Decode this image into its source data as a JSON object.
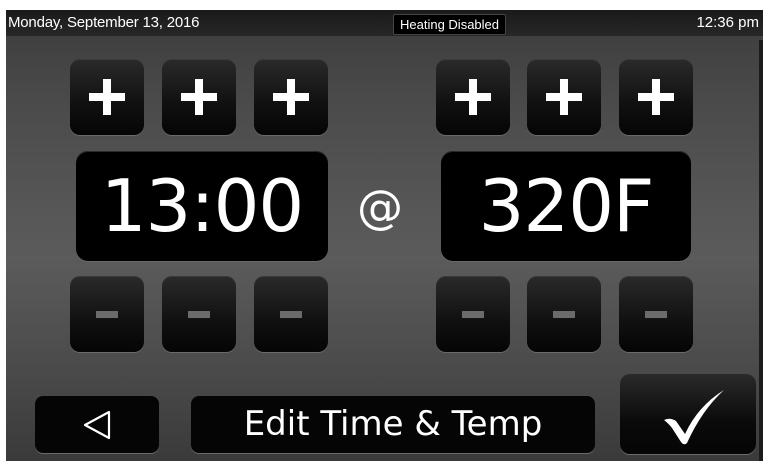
{
  "status": {
    "date": "Monday, September 13, 2016",
    "heating_status": "Heating Disabled",
    "time": "12:36 pm"
  },
  "time_display": {
    "value": "13:00"
  },
  "separator": "@",
  "temp_display": {
    "value": "320F"
  },
  "controls": {
    "increment_icon": "plus-icon",
    "decrement_icon": "minus-icon",
    "time_digit_buttons": 3,
    "temp_digit_buttons": 3
  },
  "footer": {
    "back_icon": "back-triangle-icon",
    "title": "Edit Time & Temp",
    "confirm_icon": "checkmark-icon"
  },
  "colors": {
    "background": "#4f4f4f",
    "button": "#0a0a0a",
    "text": "#ffffff",
    "minus_glyph": "#6b6b6b"
  }
}
